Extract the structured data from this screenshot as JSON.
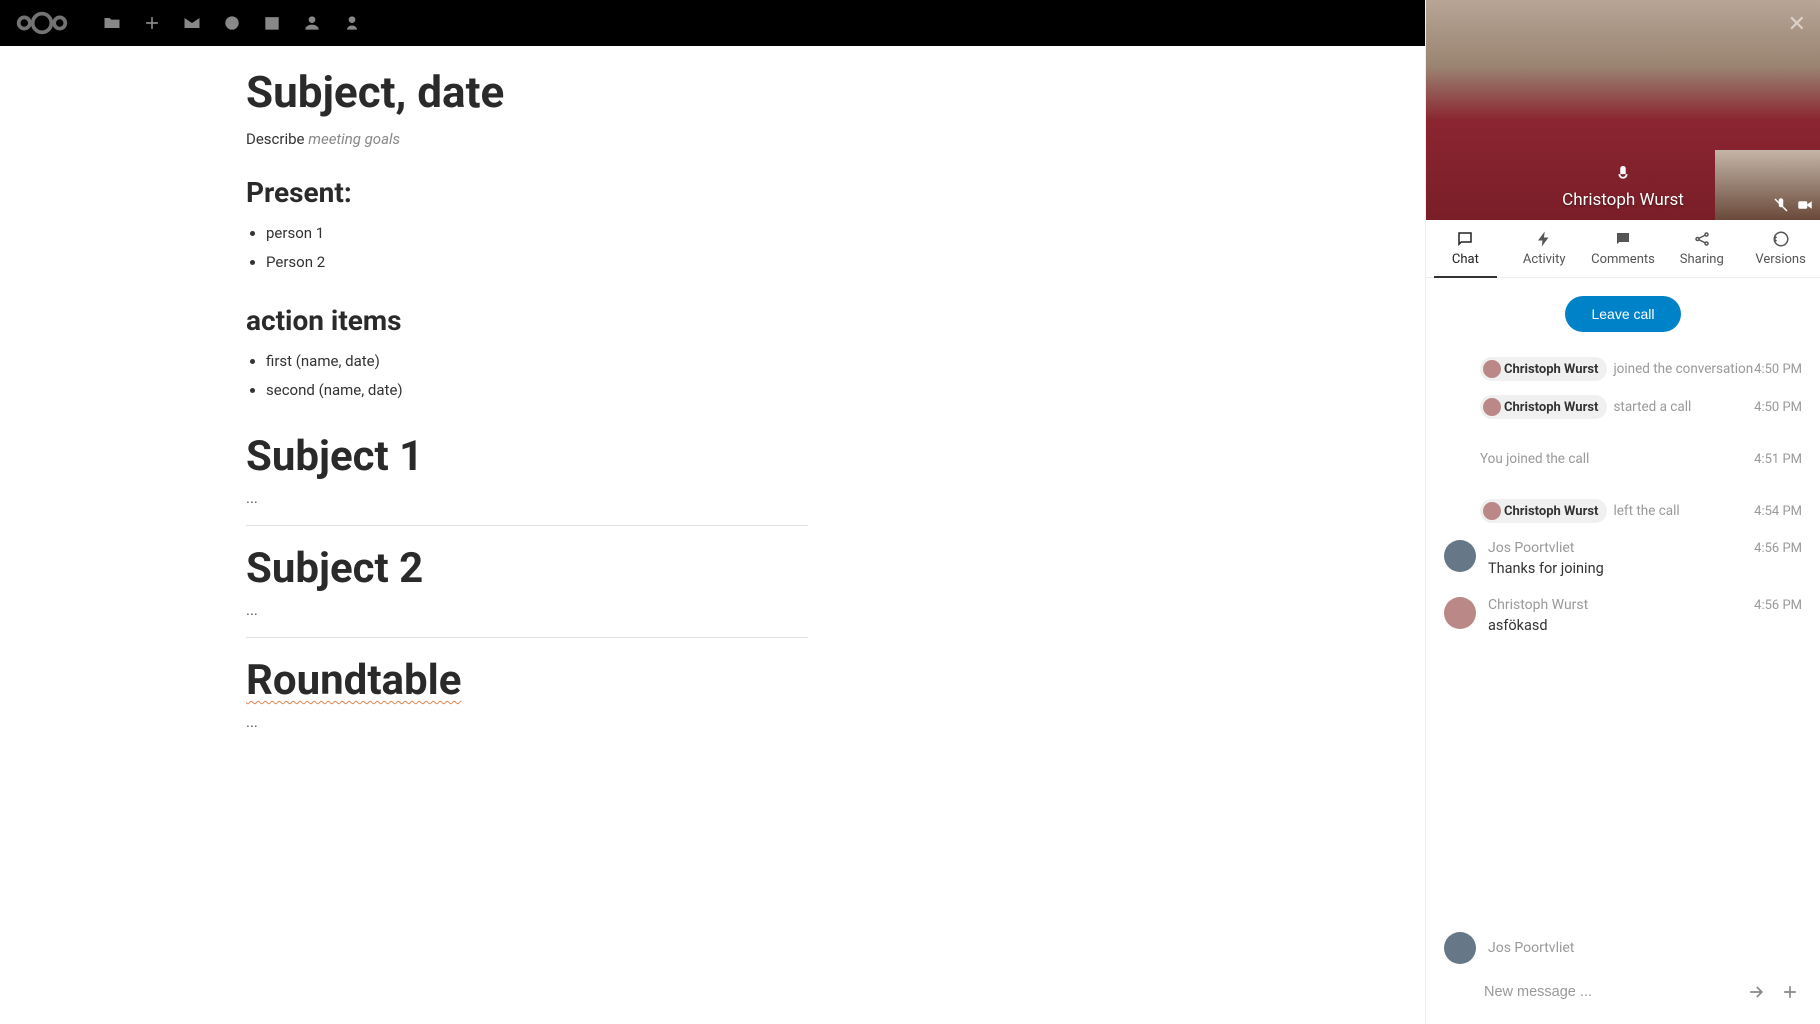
{
  "topbar": {
    "nav_icons": [
      "files-icon",
      "plus-icon",
      "mail-icon",
      "talk-icon",
      "calendar-icon",
      "contacts-icon",
      "more-icon"
    ]
  },
  "document": {
    "title": "Subject, date",
    "describe_label": "Describe ",
    "describe_goals": "meeting goals",
    "present_heading": "Present:",
    "present_items": [
      "person 1",
      "Person 2"
    ],
    "action_heading": "action items",
    "action_items": [
      "first (name, date)",
      "second (name, date)"
    ],
    "subject1_heading": "Subject 1",
    "subject1_body": "...",
    "subject2_heading": "Subject 2",
    "subject2_body": "...",
    "roundtable_heading": "Roundtable",
    "roundtable_body": "..."
  },
  "video": {
    "main_participant": "Christoph Wurst"
  },
  "tabs": {
    "chat": "Chat",
    "activity": "Activity",
    "comments": "Comments",
    "sharing": "Sharing",
    "versions": "Versions"
  },
  "call": {
    "leave_label": "Leave call"
  },
  "chat": {
    "system": [
      {
        "actor": "Christoph Wurst",
        "text": "joined the conversation",
        "time": "4:50 PM"
      },
      {
        "actor": "Christoph Wurst",
        "text": "started a call",
        "time": "4:50 PM"
      }
    ],
    "you_joined": {
      "text": "You joined the call",
      "time": "4:51 PM"
    },
    "left_call": {
      "actor": "Christoph Wurst",
      "text": "left the call",
      "time": "4:54 PM"
    },
    "messages": [
      {
        "author": "Jos Poortvliet",
        "time": "4:56 PM",
        "text": "Thanks for joining"
      },
      {
        "author": "Christoph Wurst",
        "time": "4:56 PM",
        "text": "asfökasd"
      }
    ],
    "composer_author": "Jos Poortvliet",
    "composer_placeholder": "New message ..."
  }
}
